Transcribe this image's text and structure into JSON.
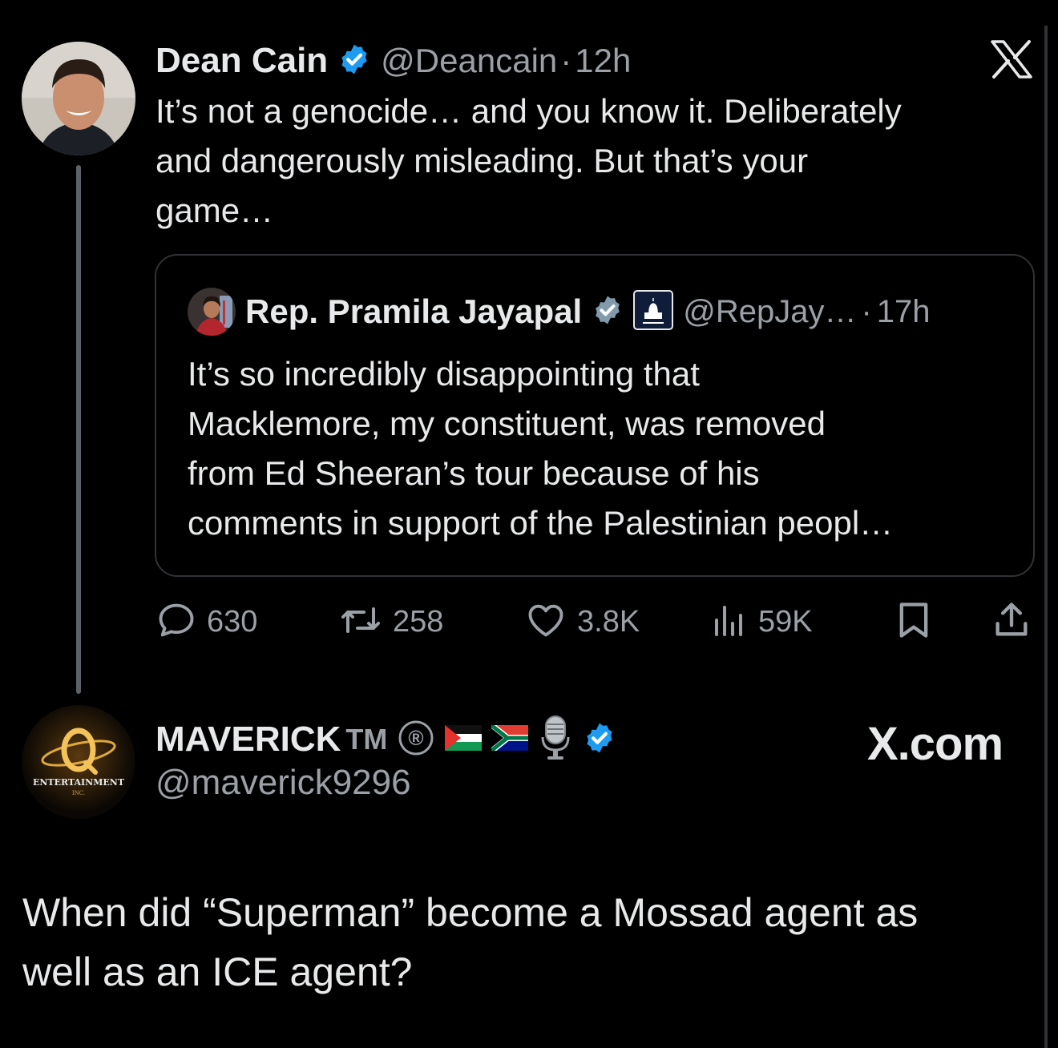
{
  "tweet1": {
    "author_name": "Dean Cain",
    "handle": "@Deancain",
    "separator": "·",
    "time": "12h",
    "text_lines": [
      "It’s not a genocide… and you know it.  Deliberately",
      "and dangerously misleading.  But that’s your",
      "game…"
    ],
    "quote": {
      "author_name": "Rep. Pramila Jayapal",
      "handle": "@RepJay…",
      "separator": "·",
      "time": "17h",
      "text_lines": [
        "It’s so incredibly disappointing that",
        "Macklemore, my constituent, was removed",
        "from Ed Sheeran’s tour because of his",
        "comments in support of the Palestinian peopl…"
      ]
    },
    "actions": {
      "replies": "630",
      "reposts": "258",
      "likes": "3.8K",
      "views": "59K"
    }
  },
  "tweet2": {
    "author_name": "MAVERICK",
    "tm": "TM",
    "registered": "®",
    "handle": "@maverick9296",
    "watermark": "X.com",
    "avatar_text": "ENTERTAINMENT",
    "avatar_subtext": "INC.",
    "text_lines": [
      "When did “Superman” become a Mossad agent as",
      "well as an ICE agent?"
    ]
  },
  "colors": {
    "background": "#000000",
    "text": "#e7e9ea",
    "secondary": "#9aa0a6",
    "verified": "#1d9bf0",
    "border": "#2f3336"
  }
}
